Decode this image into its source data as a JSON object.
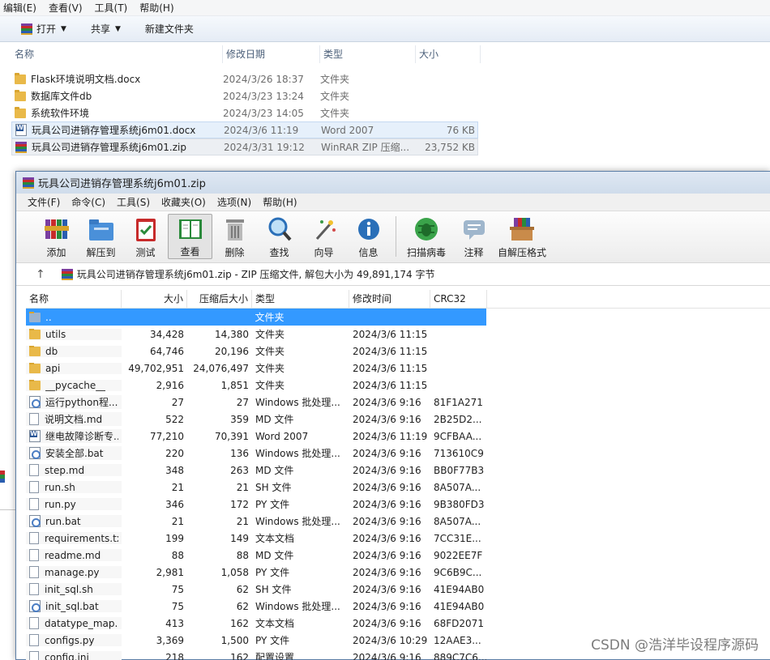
{
  "explorer": {
    "menu": [
      "编辑(E)",
      "查看(V)",
      "工具(T)",
      "帮助(H)"
    ],
    "toolbar": {
      "open": "打开",
      "share": "共享",
      "new_folder": "新建文件夹"
    },
    "columns": {
      "name": "名称",
      "date": "修改日期",
      "type": "类型",
      "size": "大小"
    },
    "rows": [
      {
        "icon": "folder",
        "name": "Flask环境说明文档.docx",
        "date": "2024/3/26 18:37",
        "type": "文件夹",
        "size": ""
      },
      {
        "icon": "folder",
        "name": "数据库文件db",
        "date": "2024/3/23 13:24",
        "type": "文件夹",
        "size": ""
      },
      {
        "icon": "folder",
        "name": "系统软件环境",
        "date": "2024/3/23 14:05",
        "type": "文件夹",
        "size": ""
      },
      {
        "icon": "word",
        "name": "玩具公司进销存管理系统j6m01.docx",
        "date": "2024/3/6 11:19",
        "type": "Word 2007",
        "size": "76 KB"
      },
      {
        "icon": "zip",
        "name": "玩具公司进销存管理系统j6m01.zip",
        "date": "2024/3/31 19:12",
        "type": "WinRAR ZIP 压缩...",
        "size": "23,752 KB"
      }
    ]
  },
  "rar": {
    "title": "玩具公司进销存管理系统j6m01.zip",
    "menu": [
      "文件(F)",
      "命令(C)",
      "工具(S)",
      "收藏夹(O)",
      "选项(N)",
      "帮助(H)"
    ],
    "toolbar": [
      "添加",
      "解压到",
      "测试",
      "查看",
      "删除",
      "查找",
      "向导",
      "信息",
      "扫描病毒",
      "注释",
      "自解压格式"
    ],
    "address": "玩具公司进销存管理系统j6m01.zip - ZIP 压缩文件, 解包大小为 49,891,174 字节",
    "columns": {
      "name": "名称",
      "size": "大小",
      "packed": "压缩后大小",
      "type": "类型",
      "modified": "修改时间",
      "crc": "CRC32"
    },
    "rows": [
      {
        "icon": "up",
        "name": "..",
        "size": "",
        "packed": "",
        "type": "文件夹",
        "modified": "",
        "crc": ""
      },
      {
        "icon": "folder",
        "name": "utils",
        "size": "34,428",
        "packed": "14,380",
        "type": "文件夹",
        "modified": "2024/3/6 11:15",
        "crc": ""
      },
      {
        "icon": "folder",
        "name": "db",
        "size": "64,746",
        "packed": "20,196",
        "type": "文件夹",
        "modified": "2024/3/6 11:15",
        "crc": ""
      },
      {
        "icon": "folder",
        "name": "api",
        "size": "49,702,951",
        "packed": "24,076,497",
        "type": "文件夹",
        "modified": "2024/3/6 11:15",
        "crc": ""
      },
      {
        "icon": "folder",
        "name": "__pycache__",
        "size": "2,916",
        "packed": "1,851",
        "type": "文件夹",
        "modified": "2024/3/6 11:15",
        "crc": ""
      },
      {
        "icon": "bat",
        "name": "运行python程...",
        "size": "27",
        "packed": "27",
        "type": "Windows 批处理...",
        "modified": "2024/3/6 9:16",
        "crc": "81F1A271"
      },
      {
        "icon": "file",
        "name": "说明文档.md",
        "size": "522",
        "packed": "359",
        "type": "MD 文件",
        "modified": "2024/3/6 9:16",
        "crc": "2B25D2..."
      },
      {
        "icon": "word",
        "name": "继电故障诊断专...",
        "size": "77,210",
        "packed": "70,391",
        "type": "Word 2007",
        "modified": "2024/3/6 11:19",
        "crc": "9CFBAA..."
      },
      {
        "icon": "bat",
        "name": "安装全部.bat",
        "size": "220",
        "packed": "136",
        "type": "Windows 批处理...",
        "modified": "2024/3/6 9:16",
        "crc": "713610C9"
      },
      {
        "icon": "file",
        "name": "step.md",
        "size": "348",
        "packed": "263",
        "type": "MD 文件",
        "modified": "2024/3/6 9:16",
        "crc": "BB0F77B3"
      },
      {
        "icon": "file",
        "name": "run.sh",
        "size": "21",
        "packed": "21",
        "type": "SH 文件",
        "modified": "2024/3/6 9:16",
        "crc": "8A507A..."
      },
      {
        "icon": "file",
        "name": "run.py",
        "size": "346",
        "packed": "172",
        "type": "PY 文件",
        "modified": "2024/3/6 9:16",
        "crc": "9B380FD3"
      },
      {
        "icon": "bat",
        "name": "run.bat",
        "size": "21",
        "packed": "21",
        "type": "Windows 批处理...",
        "modified": "2024/3/6 9:16",
        "crc": "8A507A..."
      },
      {
        "icon": "file",
        "name": "requirements.txt",
        "size": "199",
        "packed": "149",
        "type": "文本文档",
        "modified": "2024/3/6 9:16",
        "crc": "7CC31E..."
      },
      {
        "icon": "file",
        "name": "readme.md",
        "size": "88",
        "packed": "88",
        "type": "MD 文件",
        "modified": "2024/3/6 9:16",
        "crc": "9022EE7F"
      },
      {
        "icon": "file",
        "name": "manage.py",
        "size": "2,981",
        "packed": "1,058",
        "type": "PY 文件",
        "modified": "2024/3/6 9:16",
        "crc": "9C6B9C..."
      },
      {
        "icon": "file",
        "name": "init_sql.sh",
        "size": "75",
        "packed": "62",
        "type": "SH 文件",
        "modified": "2024/3/6 9:16",
        "crc": "41E94AB0"
      },
      {
        "icon": "bat",
        "name": "init_sql.bat",
        "size": "75",
        "packed": "62",
        "type": "Windows 批处理...",
        "modified": "2024/3/6 9:16",
        "crc": "41E94AB0"
      },
      {
        "icon": "file",
        "name": "datatype_map....",
        "size": "413",
        "packed": "162",
        "type": "文本文档",
        "modified": "2024/3/6 9:16",
        "crc": "68FD2071"
      },
      {
        "icon": "file",
        "name": "configs.py",
        "size": "3,369",
        "packed": "1,500",
        "type": "PY 文件",
        "modified": "2024/3/6 10:29",
        "crc": "12AAE3..."
      },
      {
        "icon": "file",
        "name": "config.ini",
        "size": "218",
        "packed": "162",
        "type": "配置设置",
        "modified": "2024/3/6 9:16",
        "crc": "889C7C6..."
      }
    ]
  },
  "watermark": "CSDN @浩洋毕设程序源码"
}
